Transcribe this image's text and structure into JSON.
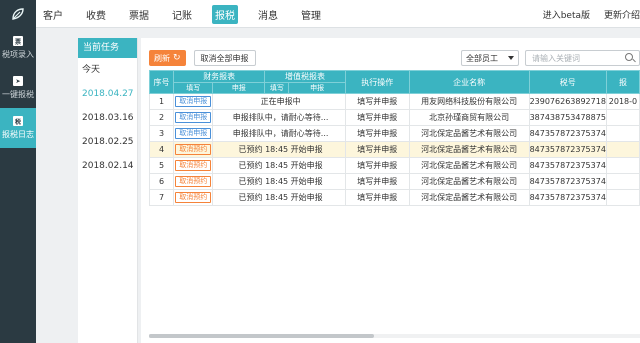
{
  "nav": {
    "items": [
      {
        "label": "客户"
      },
      {
        "label": "收费"
      },
      {
        "label": "票据"
      },
      {
        "label": "记账"
      },
      {
        "label": "报税",
        "active": true
      },
      {
        "label": "消息"
      },
      {
        "label": "管理"
      }
    ],
    "right": [
      "进入beta版",
      "更新介绍"
    ]
  },
  "sidebar": {
    "items": [
      {
        "label": "税项录入",
        "icon": "file-icon"
      },
      {
        "label": "一键报税",
        "icon": "send-icon"
      },
      {
        "label": "报税日志",
        "icon": "log-icon",
        "active": true
      }
    ]
  },
  "tasks": {
    "header": "当前任务",
    "items": [
      "今天",
      "2018.04.27",
      "2018.03.16",
      "2018.02.25",
      "2018.02.14"
    ],
    "active_index": 1
  },
  "toolbar": {
    "refresh_label": "刷新",
    "refresh_icon": "↻",
    "cancel_all_label": "取消全部申报",
    "staff_select": "全部员工",
    "search_placeholder": "请输入关键词"
  },
  "table": {
    "headers": {
      "seq": "序号",
      "finance": "财务报表",
      "vat": "增值税报表",
      "fill": "填写",
      "declare": "申报",
      "action": "执行操作",
      "company": "企业名称",
      "taxno": "税号",
      "extra": "报"
    },
    "rows": [
      {
        "seq": "1",
        "btn": "取消申报",
        "btn_color": "blue",
        "status": "正在申报中",
        "action": "填写并申报",
        "company": "用友网络科技股份有限公司",
        "taxno": "239076263892718",
        "extra": "2018-0"
      },
      {
        "seq": "2",
        "btn": "取消申报",
        "btn_color": "blue",
        "status": "申报排队中，请耐心等待...",
        "action": "填写并申报",
        "company": "北京孙瑾商贸有限公司",
        "taxno": "387438753478875",
        "extra": ""
      },
      {
        "seq": "3",
        "btn": "取消申报",
        "btn_color": "blue",
        "status": "申报排队中，请耐心等待...",
        "action": "填写并申报",
        "company": "河北保定品酱艺术有限公司",
        "taxno": "847357872375374",
        "extra": ""
      },
      {
        "seq": "4",
        "btn": "取消预约",
        "btn_color": "orange",
        "status": "已预约  18:45  开始申报",
        "action": "填写并申报",
        "company": "河北保定品酱艺术有限公司",
        "taxno": "847357872375374",
        "extra": "",
        "highlight": true
      },
      {
        "seq": "5",
        "btn": "取消预约",
        "btn_color": "orange",
        "status": "已预约  18:45  开始申报",
        "action": "填写并申报",
        "company": "河北保定品酱艺术有限公司",
        "taxno": "847357872375374",
        "extra": ""
      },
      {
        "seq": "6",
        "btn": "取消预约",
        "btn_color": "orange",
        "status": "已预约  18:45  开始申报",
        "action": "填写并申报",
        "company": "河北保定品酱艺术有限公司",
        "taxno": "847357872375374",
        "extra": ""
      },
      {
        "seq": "7",
        "btn": "取消预约",
        "btn_color": "orange",
        "status": "已预约  18:45  开始申报",
        "action": "填写并申报",
        "company": "河北保定品酱艺术有限公司",
        "taxno": "847357872375374",
        "extra": ""
      }
    ]
  },
  "colors": {
    "accent": "#3bb4c1",
    "orange": "#f5833a",
    "blue": "#4a90d9",
    "sidebar": "#2b3a42"
  }
}
